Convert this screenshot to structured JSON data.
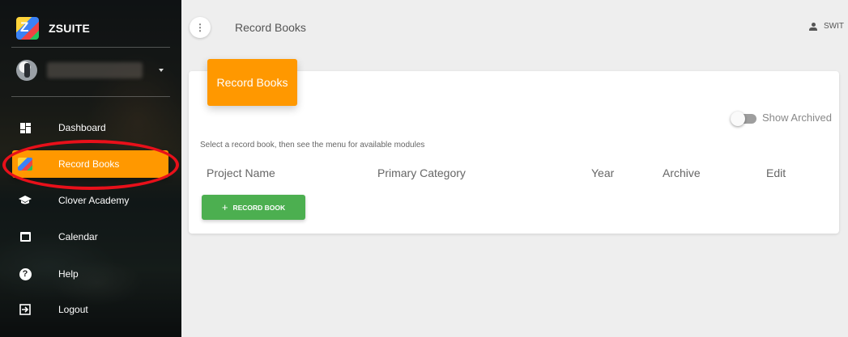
{
  "app": {
    "name": "ZSUITE"
  },
  "sidebar": {
    "items": [
      {
        "label": "Dashboard",
        "icon": "dashboard-icon"
      },
      {
        "label": "Record Books",
        "icon": "record-books-icon",
        "active": true
      },
      {
        "label": "Clover Academy",
        "icon": "graduation-cap-icon"
      },
      {
        "label": "Calendar",
        "icon": "calendar-icon"
      },
      {
        "label": "Help",
        "icon": "help-icon"
      },
      {
        "label": "Logout",
        "icon": "logout-icon"
      }
    ]
  },
  "topbar": {
    "title": "Record Books",
    "switch_label": "SWIT"
  },
  "card": {
    "header": "Record Books",
    "show_archived_label": "Show Archived",
    "show_archived": false,
    "hint": "Select a record book, then see the menu for available modules",
    "columns": [
      "Project Name",
      "Primary Category",
      "Year",
      "Archive",
      "Edit"
    ],
    "add_button": "RECORD BOOK"
  },
  "colors": {
    "accent": "#ff9800",
    "success": "#4caf50",
    "annotation": "#e8101a"
  }
}
